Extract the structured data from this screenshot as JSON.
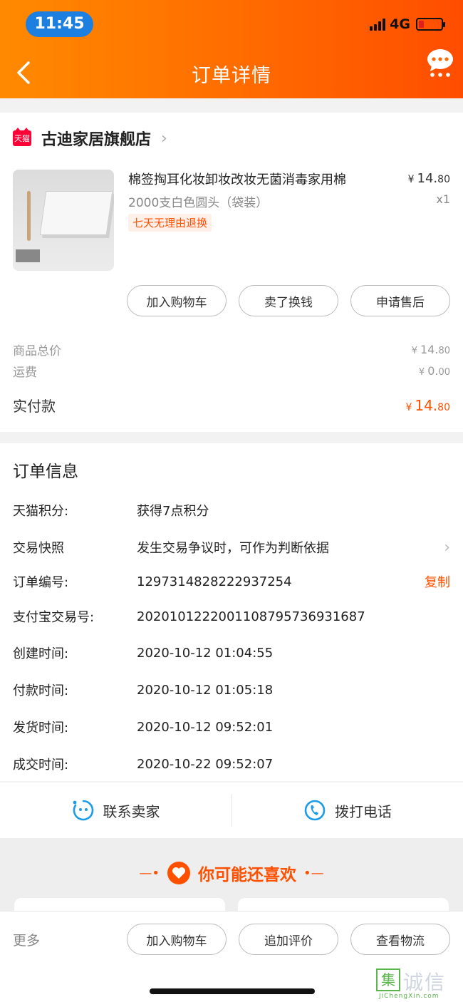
{
  "status_bar": {
    "time": "11:45",
    "network": "4G"
  },
  "header": {
    "title": "订单详情"
  },
  "shop": {
    "badge": "天猫",
    "name": "古迪家居旗舰店",
    "product": {
      "name": "棉签掏耳化妆卸妆改妆无菌消毒家用棉",
      "spec": "2000支白色圆头（袋装）",
      "tag": "七天无理由退换",
      "price_int": "14.",
      "price_dec": "80",
      "currency": "¥",
      "qty": "x1"
    },
    "actions": [
      "加入购物车",
      "卖了换钱",
      "申请售后"
    ]
  },
  "summary": {
    "goods_label": "商品总价",
    "goods_int": "14.",
    "goods_dec": "80",
    "shipping_label": "运费",
    "shipping_int": "0.",
    "shipping_dec": "00",
    "paid_label": "实付款",
    "paid_int": "14.",
    "paid_dec": "80",
    "currency": "¥"
  },
  "order_info": {
    "title": "订单信息",
    "rows": [
      {
        "label": "天猫积分:",
        "value": "获得7点积分"
      },
      {
        "label": "交易快照",
        "value": "发生交易争议时，可作为判断依据"
      },
      {
        "label": "订单编号:",
        "value": "1297314828222937254",
        "action": "复制"
      },
      {
        "label": "支付宝交易号:",
        "value": "2020101222001108795736931687"
      },
      {
        "label": "创建时间:",
        "value": "2020-10-12 01:04:55"
      },
      {
        "label": "付款时间:",
        "value": "2020-10-12 01:05:18"
      },
      {
        "label": "发货时间:",
        "value": "2020-10-12 09:52:01"
      },
      {
        "label": "成交时间:",
        "value": "2020-10-22 09:52:07"
      }
    ]
  },
  "contact": {
    "seller": "联系卖家",
    "phone": "拨打电话"
  },
  "recommend": {
    "title": "你可能还喜欢"
  },
  "bottom_bar": {
    "more": "更多",
    "buttons": [
      "加入购物车",
      "追加评价",
      "查看物流"
    ]
  },
  "watermark": {
    "char": "集",
    "text": "诚信",
    "url": "JiChengXin.com"
  },
  "colors": {
    "accent": "#ff5000",
    "header_start": "#ff8a00",
    "header_end": "#ff4d00"
  }
}
